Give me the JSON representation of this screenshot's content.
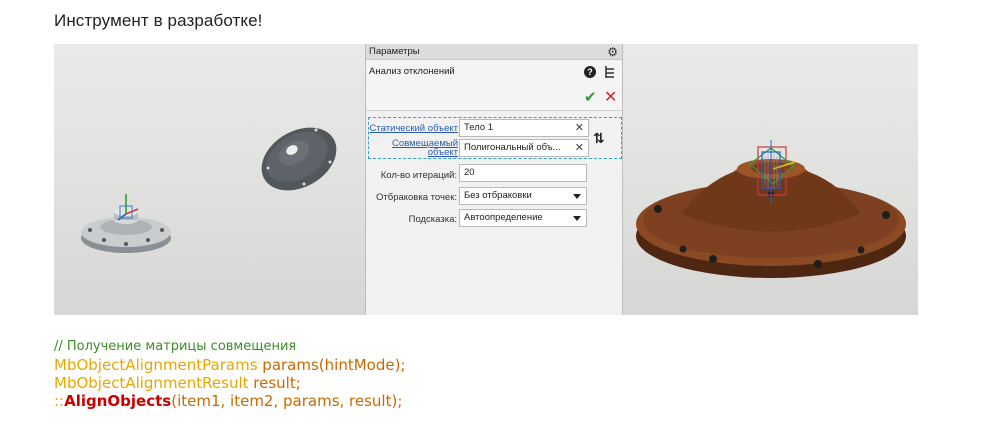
{
  "heading": "Инструмент в разработке!",
  "panel": {
    "title": "Параметры",
    "command": "Анализ отклонений",
    "fields": [
      {
        "label": "Статический объект",
        "value": "Тело 1",
        "type": "object"
      },
      {
        "label": "Совмещаемый объект",
        "value": "Полигональный объ...",
        "type": "object"
      },
      {
        "label": "Кол-во итераций:",
        "value": "20",
        "type": "number"
      },
      {
        "label": "Отбраковка точек:",
        "value": "Без отбраковки",
        "type": "select"
      },
      {
        "label": "Подсказка:",
        "value": "Автоопределение",
        "type": "select"
      }
    ],
    "icons": {
      "settings": "gear-icon",
      "help": "help-icon",
      "tree": "tree-icon",
      "ok": "check-icon",
      "cancel": "close-icon",
      "swap": "swap-icon"
    }
  },
  "code": {
    "comment": "// Получение матрицы совмещения",
    "line1": {
      "type": "MbObjectAlignmentParams",
      "rest": " params(hintMode);"
    },
    "line2": {
      "type": "MbObjectAlignmentResult",
      "rest": " result;"
    },
    "line3": {
      "prefix": "::",
      "fn": "AlignObjects",
      "rest": "(item1, item2, params, result);"
    }
  },
  "colors": {
    "accent_link": "#2a5db0",
    "ok": "#2a9d2a",
    "cancel": "#d42525",
    "selection_border": "#3a9fc5",
    "model_body": "#7a3e1c",
    "comment": "#3c8c2a",
    "code_type": "#e8a700",
    "code_fn": "#c80000"
  }
}
